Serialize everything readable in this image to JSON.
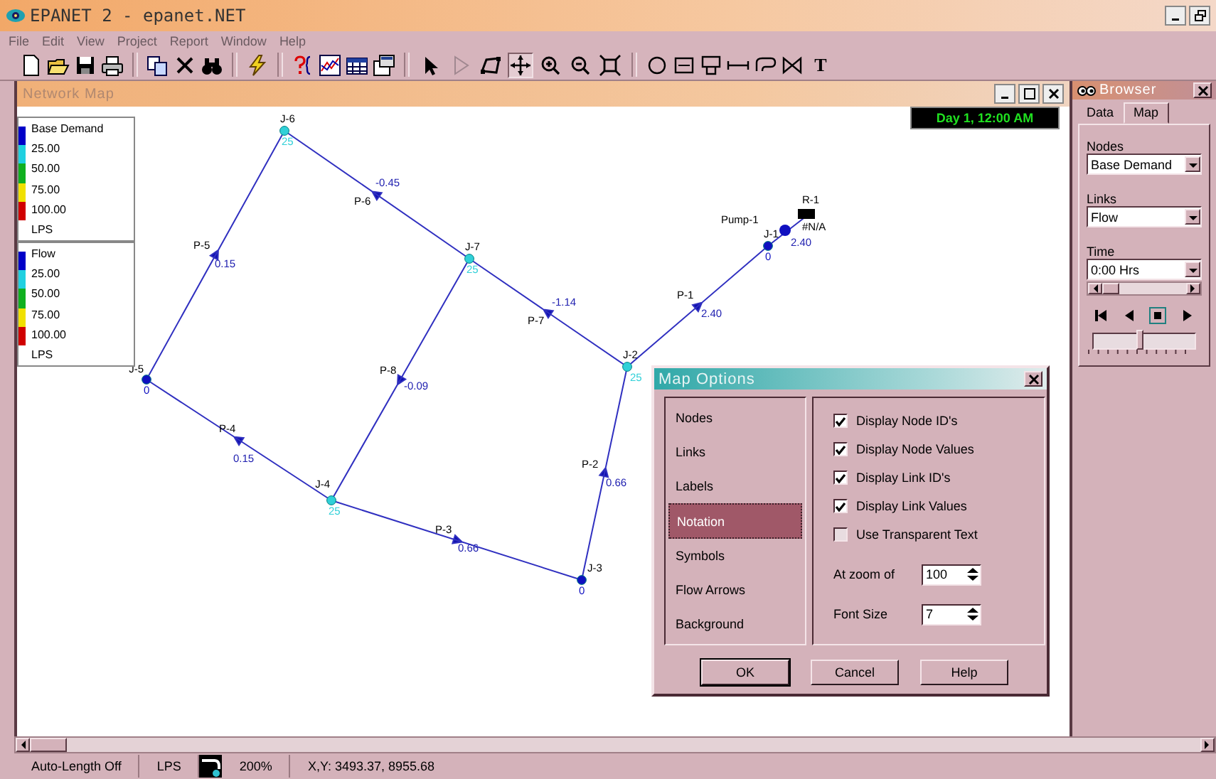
{
  "window": {
    "title": "EPANET 2 - epanet.NET"
  },
  "menu": [
    "File",
    "Edit",
    "View",
    "Project",
    "Report",
    "Window",
    "Help"
  ],
  "toolbar": {
    "map_tools": [
      {
        "kind": "pointer",
        "selected": false
      },
      {
        "kind": "vertex",
        "selected": false
      },
      {
        "kind": "polygon",
        "selected": false
      },
      {
        "kind": "pan",
        "selected": true
      },
      {
        "kind": "zoom_in",
        "selected": false
      },
      {
        "kind": "zoom_out",
        "selected": false
      },
      {
        "kind": "full_extent",
        "selected": false
      }
    ],
    "text_tool": "T"
  },
  "map_window": {
    "title": "Network Map",
    "time_display": "Day 1, 12:00 AM",
    "legends": [
      {
        "title": "Base Demand",
        "color_scale": [
          {
            "color": "#0000c8"
          },
          {
            "color": "#20d0e0"
          },
          {
            "color": "#10b020"
          },
          {
            "color": "#f0e000"
          },
          {
            "color": "#d00000"
          }
        ],
        "labels": [
          "25.00",
          "50.00",
          "75.00",
          "100.00"
        ],
        "units": "LPS"
      },
      {
        "title": "Flow",
        "color_scale": [
          {
            "color": "#0000c8"
          },
          {
            "color": "#20d0e0"
          },
          {
            "color": "#10b020"
          },
          {
            "color": "#f0e000"
          },
          {
            "color": "#d00000"
          }
        ],
        "labels": [
          "25.00",
          "50.00",
          "75.00",
          "100.00"
        ],
        "units": "LPS"
      }
    ],
    "nodes": [
      {
        "id": "J-6",
        "value": "25",
        "color": "#30d0d8"
      },
      {
        "id": "J-7",
        "value": "25",
        "color": "#30d0d8"
      },
      {
        "id": "J-1",
        "value": "0",
        "color": "#1010c0"
      },
      {
        "id": "J-2",
        "value": "25",
        "color": "#30d0d8"
      },
      {
        "id": "J-5",
        "value": "0",
        "color": "#1010c0"
      },
      {
        "id": "J-4",
        "value": "25",
        "color": "#30d0d8"
      },
      {
        "id": "J-3",
        "value": "0",
        "color": "#1010c0"
      }
    ],
    "pump": {
      "id": "Pump-1",
      "value": "2.40"
    },
    "reservoir": {
      "id": "R-1",
      "value": "#N/A"
    },
    "links": [
      {
        "id": "P-6",
        "value": "-0.45"
      },
      {
        "id": "P-5",
        "value": "0.15"
      },
      {
        "id": "P-7",
        "value": "-1.14"
      },
      {
        "id": "P-1",
        "value": "2.40"
      },
      {
        "id": "P-8",
        "value": "-0.09"
      },
      {
        "id": "P-4",
        "value": "0.15"
      },
      {
        "id": "P-2",
        "value": "0.66"
      },
      {
        "id": "P-3",
        "value": "0.66"
      }
    ]
  },
  "browser": {
    "title": "Browser",
    "tabs": [
      {
        "label": "Data",
        "selected": false
      },
      {
        "label": "Map",
        "selected": true
      }
    ],
    "nodes_label": "Nodes",
    "nodes_value": "Base Demand",
    "links_label": "Links",
    "links_value": "Flow",
    "time_label": "Time",
    "time_value": "0:00 Hrs",
    "speed": {
      "level": 0.45
    }
  },
  "map_options": {
    "title": "Map Options",
    "categories": [
      {
        "label": "Nodes",
        "selected": false
      },
      {
        "label": "Links",
        "selected": false
      },
      {
        "label": "Labels",
        "selected": false
      },
      {
        "label": "Notation",
        "selected": true
      },
      {
        "label": "Symbols",
        "selected": false
      },
      {
        "label": "Flow Arrows",
        "selected": false
      },
      {
        "label": "Background",
        "selected": false
      }
    ],
    "options": [
      {
        "label": "Display Node ID's",
        "checked": true
      },
      {
        "label": "Display Node Values",
        "checked": true
      },
      {
        "label": "Display Link ID's",
        "checked": true
      },
      {
        "label": "Display Link Values",
        "checked": true
      },
      {
        "label": "Use Transparent Text",
        "checked": false
      }
    ],
    "zoom_label": "At zoom of",
    "zoom_value": "100",
    "font_size_label": "Font Size",
    "font_size_value": "7",
    "buttons": [
      "OK",
      "Cancel",
      "Help"
    ]
  },
  "status_bar": {
    "auto_length": "Auto-Length Off",
    "units": "LPS",
    "zoom": "200%",
    "coordinates": "X,Y: 3493.37, 8955.68"
  }
}
